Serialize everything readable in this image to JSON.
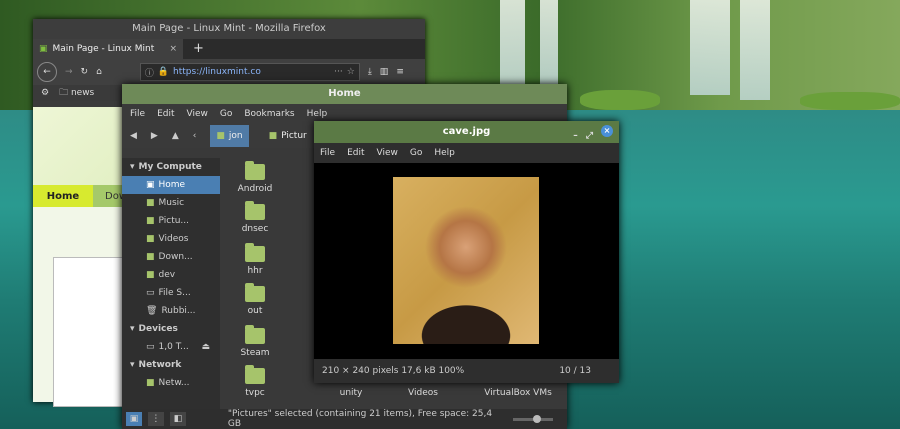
{
  "firefox": {
    "window_title": "Main Page - Linux Mint - Mozilla Firefox",
    "tab_label": "Main Page - Linux Mint",
    "url": "https://linuxmint.co",
    "bookmark": "news",
    "page_menu_home": "Home",
    "page_menu_next": "Dow"
  },
  "filemanager": {
    "window_title": "Home",
    "menu": [
      "File",
      "Edit",
      "View",
      "Go",
      "Bookmarks",
      "Help"
    ],
    "crumbs": [
      "jon",
      "Pictur"
    ],
    "sidebar": {
      "my_computer": "My Compute",
      "items": [
        "Home",
        "Music",
        "Pictu...",
        "Videos",
        "Down...",
        "dev",
        "File S...",
        "Rubbi..."
      ],
      "devices": "Devices",
      "device_item": "1,0 T...",
      "network": "Network",
      "network_item": "Netw..."
    },
    "files": [
      "Android",
      "dnsec",
      "hhr",
      "out",
      "Steam",
      "tvpc"
    ],
    "bottom_row": [
      "unity",
      "Videos",
      "VirtualBox VMs"
    ],
    "status": "\"Pictures\" selected (containing 21 items), Free space: 25,4 GB"
  },
  "viewer": {
    "window_title": "cave.jpg",
    "menu": [
      "File",
      "Edit",
      "View",
      "Go",
      "Help"
    ],
    "info": "210 × 240 pixels  17,6 kB   100%",
    "counter": "10 / 13"
  }
}
